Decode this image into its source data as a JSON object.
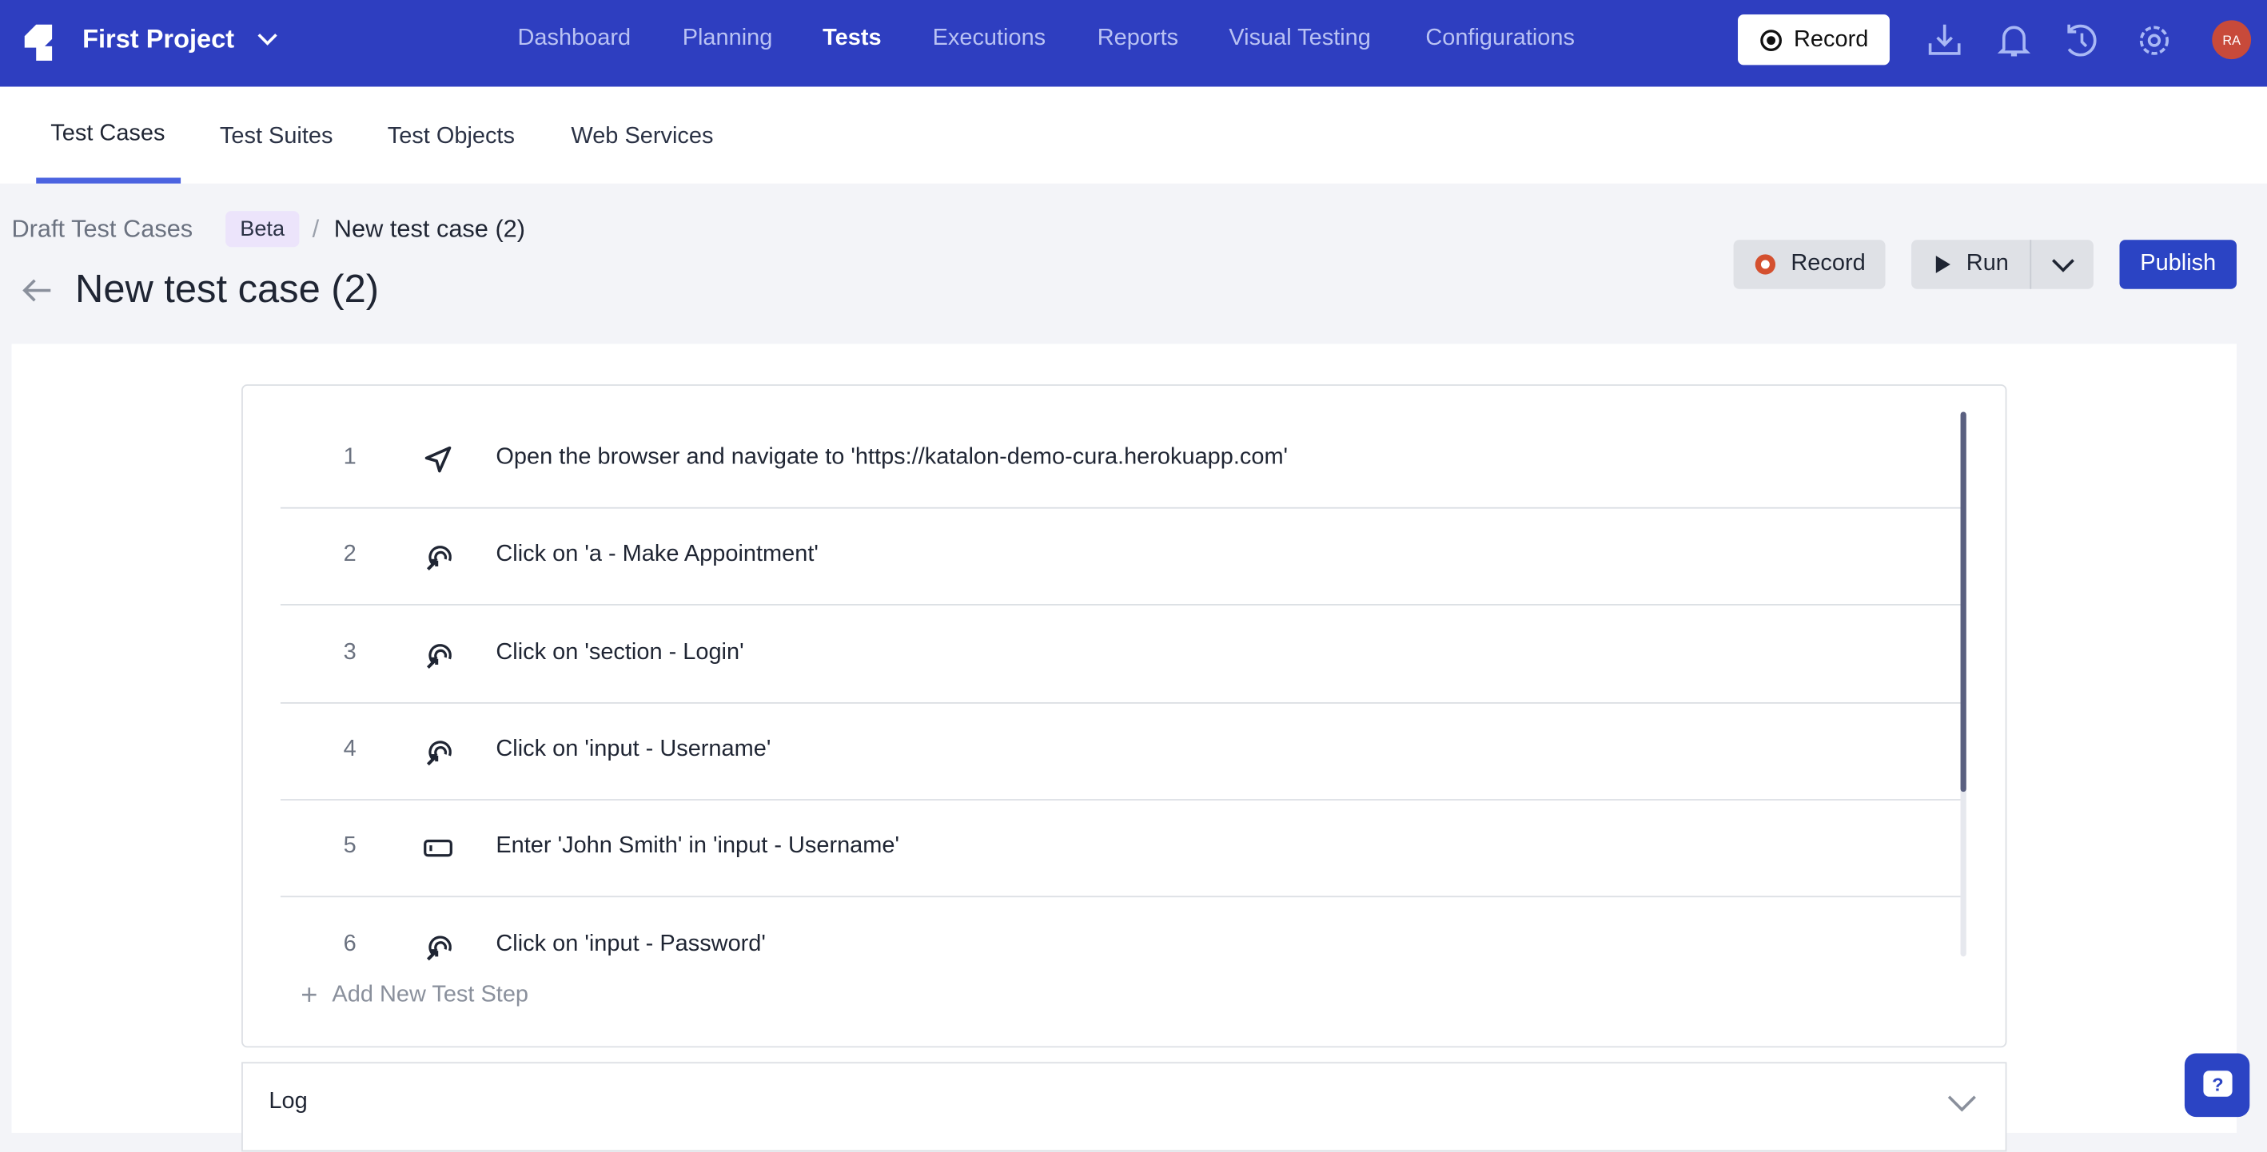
{
  "topbar": {
    "project": "First Project",
    "nav": [
      "Dashboard",
      "Planning",
      "Tests",
      "Executions",
      "Reports",
      "Visual Testing",
      "Configurations"
    ],
    "active_nav": "Tests",
    "record_label": "Record",
    "avatar_initials": "RA",
    "icons": [
      "download-icon",
      "bell-icon",
      "history-icon",
      "gear-icon"
    ],
    "colors": {
      "bar": "#2e3ec0",
      "avatar": "#c84a3a"
    }
  },
  "subnav": {
    "tabs": [
      "Test Cases",
      "Test Suites",
      "Test Objects",
      "Web Services"
    ],
    "active": "Test Cases"
  },
  "breadcrumb": {
    "parent": "Draft Test Cases",
    "badge": "Beta",
    "separator": "/",
    "current": "New test case (2)"
  },
  "page": {
    "title": "New test case (2)"
  },
  "actions": {
    "record": "Record",
    "run": "Run",
    "publish": "Publish"
  },
  "steps": [
    {
      "n": "1",
      "icon": "navigate-icon",
      "text": "Open the browser and navigate to 'https://katalon-demo-cura.herokuapp.com'"
    },
    {
      "n": "2",
      "icon": "click-icon",
      "text": "Click on 'a - Make Appointment'"
    },
    {
      "n": "3",
      "icon": "click-icon",
      "text": "Click on 'section - Login'"
    },
    {
      "n": "4",
      "icon": "click-icon",
      "text": "Click on 'input - Username'"
    },
    {
      "n": "5",
      "icon": "input-icon",
      "text": "Enter 'John Smith' in 'input - Username'"
    },
    {
      "n": "6",
      "icon": "click-icon",
      "text": "Click on 'input - Password'"
    }
  ],
  "add_step": "Add New Test Step",
  "log": {
    "label": "Log"
  }
}
